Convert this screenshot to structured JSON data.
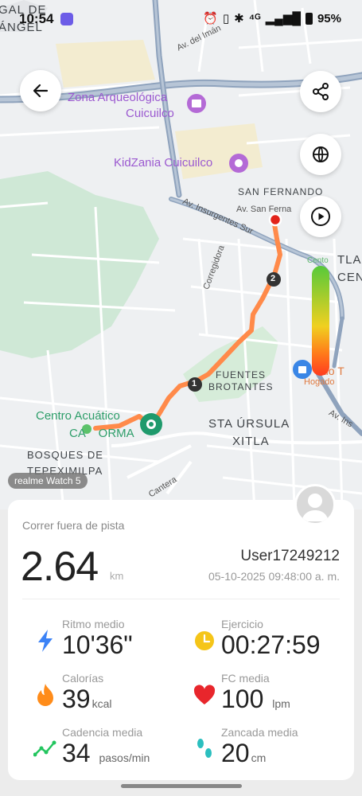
{
  "status_bar": {
    "time": "10:54",
    "signal_text": "⁴ᴳ",
    "battery": "95%"
  },
  "map": {
    "labels": {
      "gal_de_angel": "GAL DE\nÁNGEL",
      "av_del_iman": "Av. del Imán",
      "zona_arqueologica": "Zona Arqueológica",
      "cuicuilco": "Cuicuilco",
      "kidzania": "KidZania Cuicuilco",
      "san_fernando": "SAN FERNANDO",
      "av_san_fern": "Av. San Ferna",
      "av_insurgentes": "Av. Insurgentes Sur",
      "corregidora": "Corregidora",
      "tla": "TLA",
      "cen": "CEN",
      "fuentes": "FUENTES",
      "brotantes": "BROTANTES",
      "patio_t": "atio T",
      "patio_sub": "Hogado",
      "centro_acuatico": "Centro Acuático",
      "ca_orma": "CA    ORMA",
      "sta_ursula": "STA ÚRSULA",
      "xitla": "XITLA",
      "bosques": "BOSQUES DE",
      "tepeximilpa": "TEPEXIMILPA",
      "av_ins_sur_2": "Av. Ins",
      "cantera": "Cantera",
      "km_marker_1": "1",
      "km_marker_2": "2",
      "gradient_top": "Cento"
    },
    "watch_chip": "realme Watch 5"
  },
  "activity": {
    "type": "Correr fuera de pista",
    "distance": "2.64",
    "distance_unit": "km",
    "user": "User17249212",
    "datetime": "05-10-2025 09:48:00 a. m."
  },
  "stats": {
    "pace": {
      "label": "Ritmo medio",
      "value": "10'36\"",
      "unit": ""
    },
    "exercise": {
      "label": "Ejercicio",
      "value": "00:27:59",
      "unit": ""
    },
    "calories": {
      "label": "Calorías",
      "value": "39",
      "unit": "kcal"
    },
    "hr": {
      "label": "FC media",
      "value": "100",
      "unit": "lpm"
    },
    "cadence": {
      "label": "Cadencia media",
      "value": "34",
      "unit": "pasos/min"
    },
    "stride": {
      "label": "Zancada media",
      "value": "20",
      "unit": "cm"
    }
  },
  "colors": {
    "route": "#ff8a4a",
    "pace_icon": "#3b82f6",
    "exercise_icon": "#f5c518",
    "calories_icon": "#ff8c1a",
    "hr_icon": "#e8262c",
    "cadence_icon": "#22c55e",
    "stride_icon": "#2bbfbf"
  },
  "icons": [
    "back-arrow-icon",
    "share-icon",
    "globe-icon",
    "play-icon",
    "lightning-icon",
    "clock-icon",
    "flame-icon",
    "heart-icon",
    "cadence-icon",
    "footprints-icon"
  ]
}
